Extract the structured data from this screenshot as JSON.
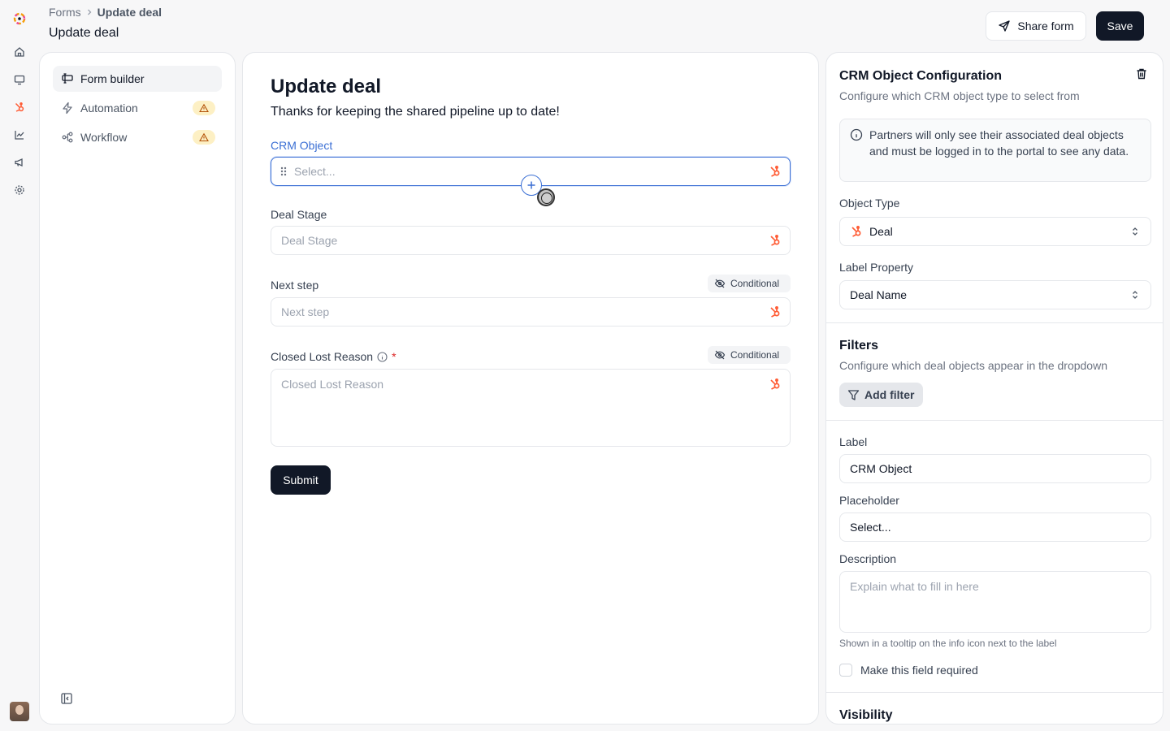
{
  "breadcrumb": {
    "parent": "Forms",
    "current": "Update deal"
  },
  "page_title": "Update deal",
  "header": {
    "share_label": "Share form",
    "save_label": "Save"
  },
  "sidebar": {
    "items": [
      {
        "label": "Form builder",
        "icon": "form-builder-icon",
        "active": true,
        "warning": false
      },
      {
        "label": "Automation",
        "icon": "lightning-icon",
        "active": false,
        "warning": true
      },
      {
        "label": "Workflow",
        "icon": "workflow-icon",
        "active": false,
        "warning": true
      }
    ]
  },
  "form": {
    "title": "Update deal",
    "subtitle": "Thanks for keeping the shared pipeline up to date!",
    "fields": [
      {
        "label": "CRM Object",
        "placeholder": "Select...",
        "selected": true
      },
      {
        "label": "Deal Stage",
        "placeholder": "Deal Stage"
      },
      {
        "label": "Next step",
        "placeholder": "Next step",
        "badge": "Conditional"
      },
      {
        "label": "Closed Lost Reason",
        "placeholder": "Closed Lost Reason",
        "badge": "Conditional",
        "required_mark": "*"
      }
    ],
    "submit_label": "Submit"
  },
  "config": {
    "title": "CRM Object Configuration",
    "subtitle": "Configure which CRM object type to select from",
    "info": "Partners will only see their associated deal objects and must be logged in to the portal to see any data.",
    "object_type_label": "Object Type",
    "object_type_value": "Deal",
    "label_property_label": "Label Property",
    "label_property_value": "Deal Name",
    "filters_title": "Filters",
    "filters_subtitle": "Configure which deal objects appear in the dropdown",
    "add_filter_label": "Add filter",
    "label_label": "Label",
    "label_value": "CRM Object",
    "placeholder_label": "Placeholder",
    "placeholder_value": "Select...",
    "description_label": "Description",
    "description_placeholder": "Explain what to fill in here",
    "description_hint": "Shown in a tooltip on the info icon next to the label",
    "required_label": "Make this field required",
    "visibility_title": "Visibility"
  },
  "colors": {
    "primary": "#111827",
    "accent": "#3b6fd4",
    "hubspot": "#ff5c35",
    "warning_bg": "#fdf0c4"
  }
}
